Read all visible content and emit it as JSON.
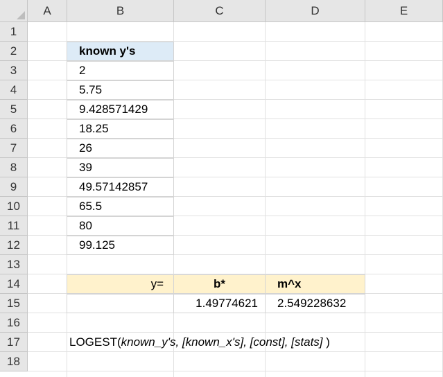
{
  "columns": [
    "A",
    "B",
    "C",
    "D",
    "E"
  ],
  "rows": [
    "1",
    "2",
    "3",
    "4",
    "5",
    "6",
    "7",
    "8",
    "9",
    "10",
    "11",
    "12",
    "13",
    "14",
    "15",
    "16",
    "17",
    "18"
  ],
  "known_ys": {
    "header": "known y's",
    "values": [
      "2",
      "5.75",
      "9.428571429",
      "18.25",
      "26",
      "39",
      "49.57142857",
      "65.5",
      "80",
      "99.125"
    ]
  },
  "result": {
    "label": "y=",
    "b_header": "b*",
    "m_header": "m^x",
    "b_value": "1.49774621",
    "m_value": "2.549228632"
  },
  "formula": {
    "name": "LOGEST(",
    "args": "known_y's, [known_x's], [const], [stats]",
    "close": " )"
  }
}
